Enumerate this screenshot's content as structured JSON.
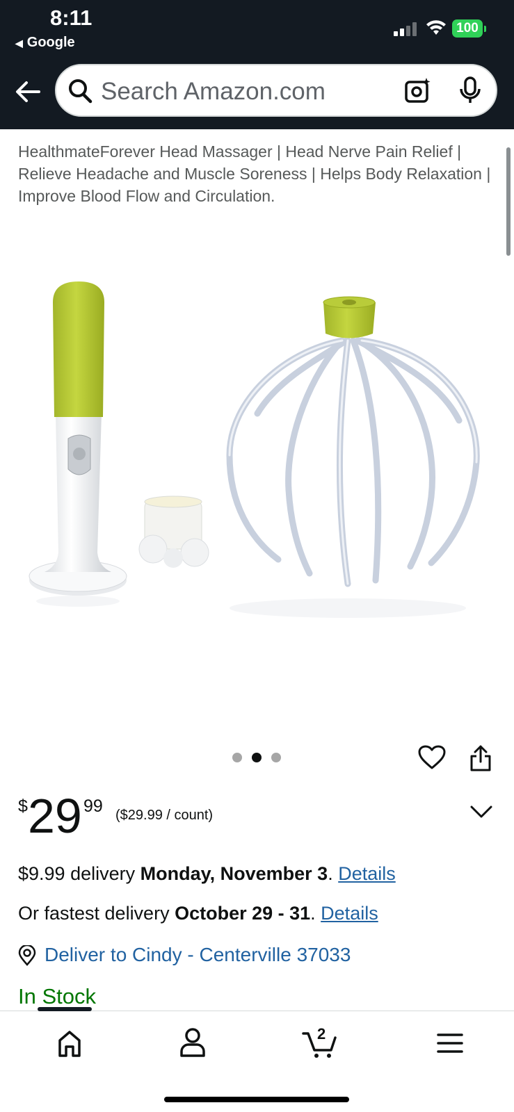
{
  "status_bar": {
    "time": "8:11",
    "back_app": "Google",
    "battery": "100"
  },
  "header": {
    "search_placeholder": "Search Amazon.com"
  },
  "product": {
    "title": "HealthmateForever Head Massager | Head Nerve Pain Relief | Relieve Headache and Muscle Soreness | Helps Body Relaxation | Improve Blood Flow and Circulation.",
    "image_count": 3,
    "image_active_index": 1
  },
  "price": {
    "symbol": "$",
    "whole": "29",
    "fraction": "99",
    "unit_price": "($29.99 / count)"
  },
  "delivery": {
    "prefix": "$9.99 delivery ",
    "date": "Monday, November 3",
    "period": ". ",
    "details_link": "Details",
    "fast_prefix": "Or fastest delivery ",
    "fast_date": "October 29 - 31",
    "fast_period": ". ",
    "fast_details_link": "Details",
    "deliver_to": "Deliver to Cindy - Centerville 37033"
  },
  "stock": {
    "status": "In Stock"
  },
  "tabbar": {
    "cart_count": "2"
  },
  "colors": {
    "header_bg": "#131a22",
    "link": "#2162a1",
    "in_stock": "#007600",
    "product_green": "#b5c932"
  }
}
